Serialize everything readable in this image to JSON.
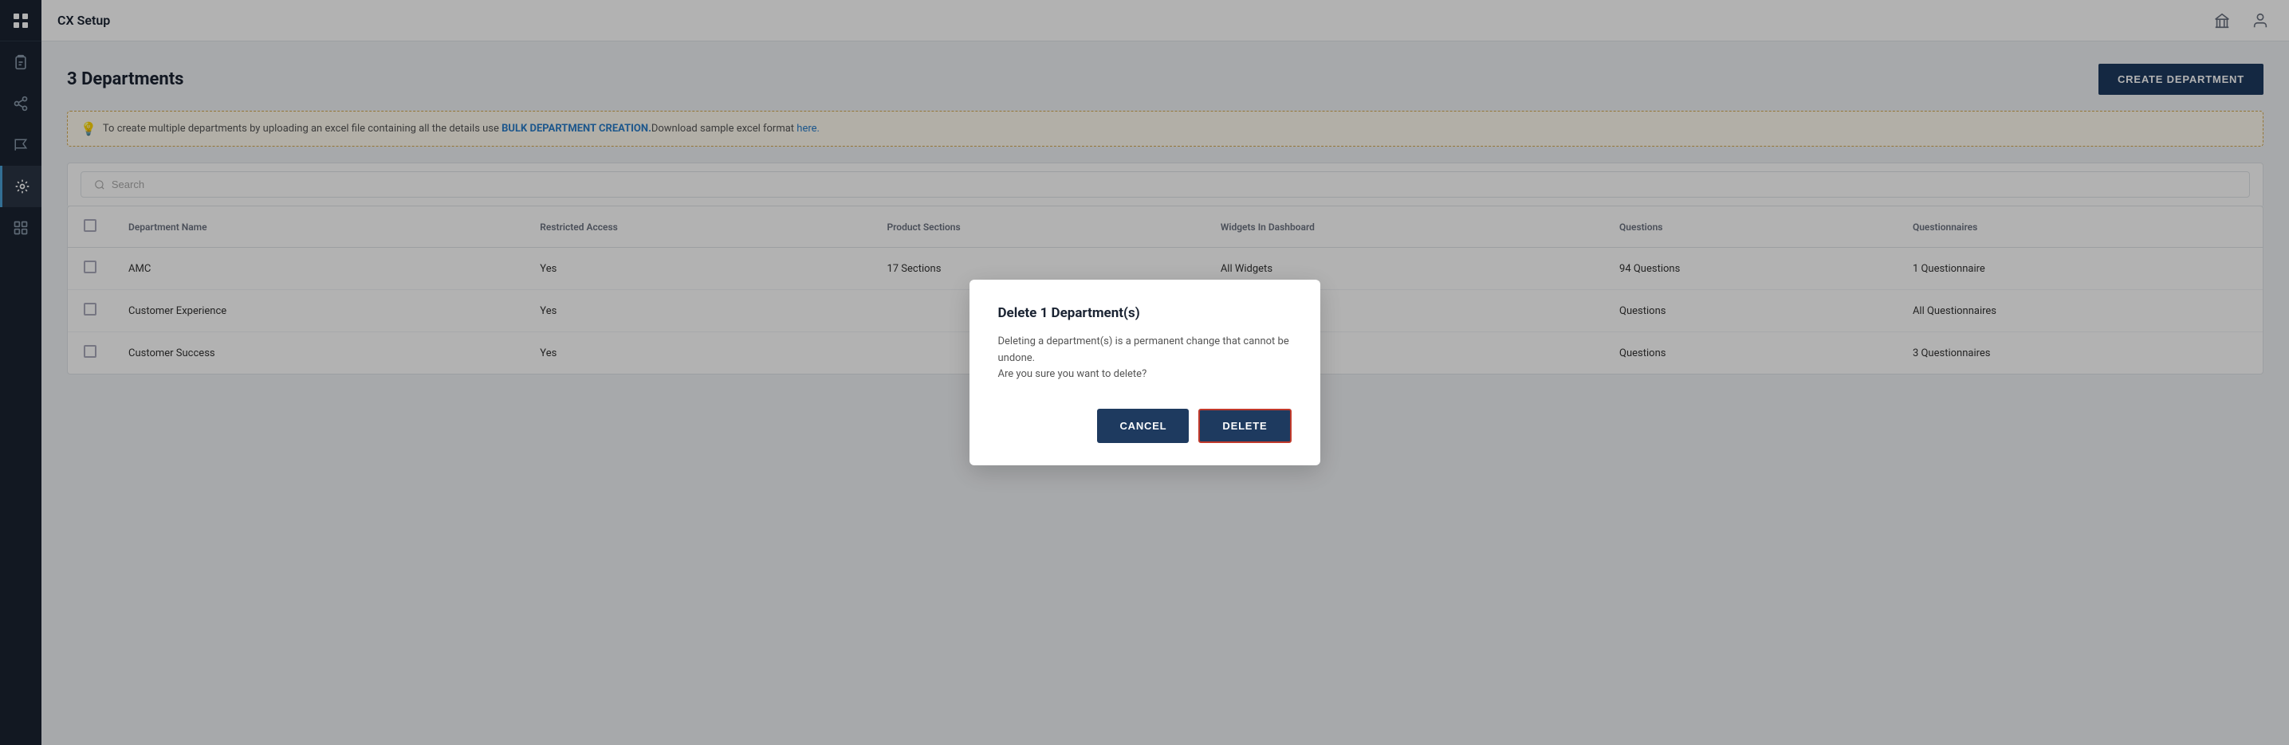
{
  "sidebar": {
    "logo_icon": "grid-icon",
    "app_title": "CX Setup",
    "items": [
      {
        "id": "dashboard",
        "icon": "clipboard-icon",
        "label": "Dashboard",
        "active": false
      },
      {
        "id": "share",
        "icon": "share-icon",
        "label": "Share",
        "active": false
      },
      {
        "id": "flag",
        "icon": "flag-icon",
        "label": "Flag",
        "active": false
      },
      {
        "id": "departments",
        "icon": "departments-icon",
        "label": "Departments",
        "active": true
      },
      {
        "id": "widgets",
        "icon": "widgets-icon",
        "label": "Widgets",
        "active": false
      }
    ]
  },
  "topbar": {
    "title": "CX Setup",
    "icons": [
      "bank-icon",
      "user-icon"
    ]
  },
  "page": {
    "count": "3",
    "title_suffix": "Departments",
    "create_button_label": "CREATE DEPARTMENT"
  },
  "info_banner": {
    "icon": "lightbulb-icon",
    "text_before": "To create multiple departments by uploading an excel file containing all the details use ",
    "bulk_link_text": "BULK DEPARTMENT CREATION.",
    "text_after": "Download sample excel format ",
    "here_link_text": "here."
  },
  "search": {
    "placeholder": "Search"
  },
  "table": {
    "columns": [
      {
        "id": "checkbox",
        "label": ""
      },
      {
        "id": "name",
        "label": "Department Name"
      },
      {
        "id": "restricted",
        "label": "Restricted Access"
      },
      {
        "id": "sections",
        "label": "Product Sections"
      },
      {
        "id": "widgets",
        "label": "Widgets In Dashboard"
      },
      {
        "id": "questions",
        "label": "Questions"
      },
      {
        "id": "questionnaires",
        "label": "Questionnaires"
      }
    ],
    "rows": [
      {
        "name": "AMC",
        "restricted": "Yes",
        "sections": "17 Sections",
        "widgets": "All Widgets",
        "questions": "94 Questions",
        "questionnaires": "1 Questionnaire"
      },
      {
        "name": "Customer Experience",
        "restricted": "Yes",
        "sections": "",
        "widgets": "",
        "questions": "Questions",
        "questionnaires": "All Questionnaires"
      },
      {
        "name": "Customer Success",
        "restricted": "Yes",
        "sections": "",
        "widgets": "",
        "questions": "Questions",
        "questionnaires": "3 Questionnaires"
      }
    ]
  },
  "modal": {
    "title": "Delete 1 Department(s)",
    "body_line1": "Deleting a department(s) is a permanent change that cannot be undone.",
    "body_line2": "Are you sure you want to delete?",
    "cancel_label": "CANCEL",
    "delete_label": "DELETE"
  }
}
